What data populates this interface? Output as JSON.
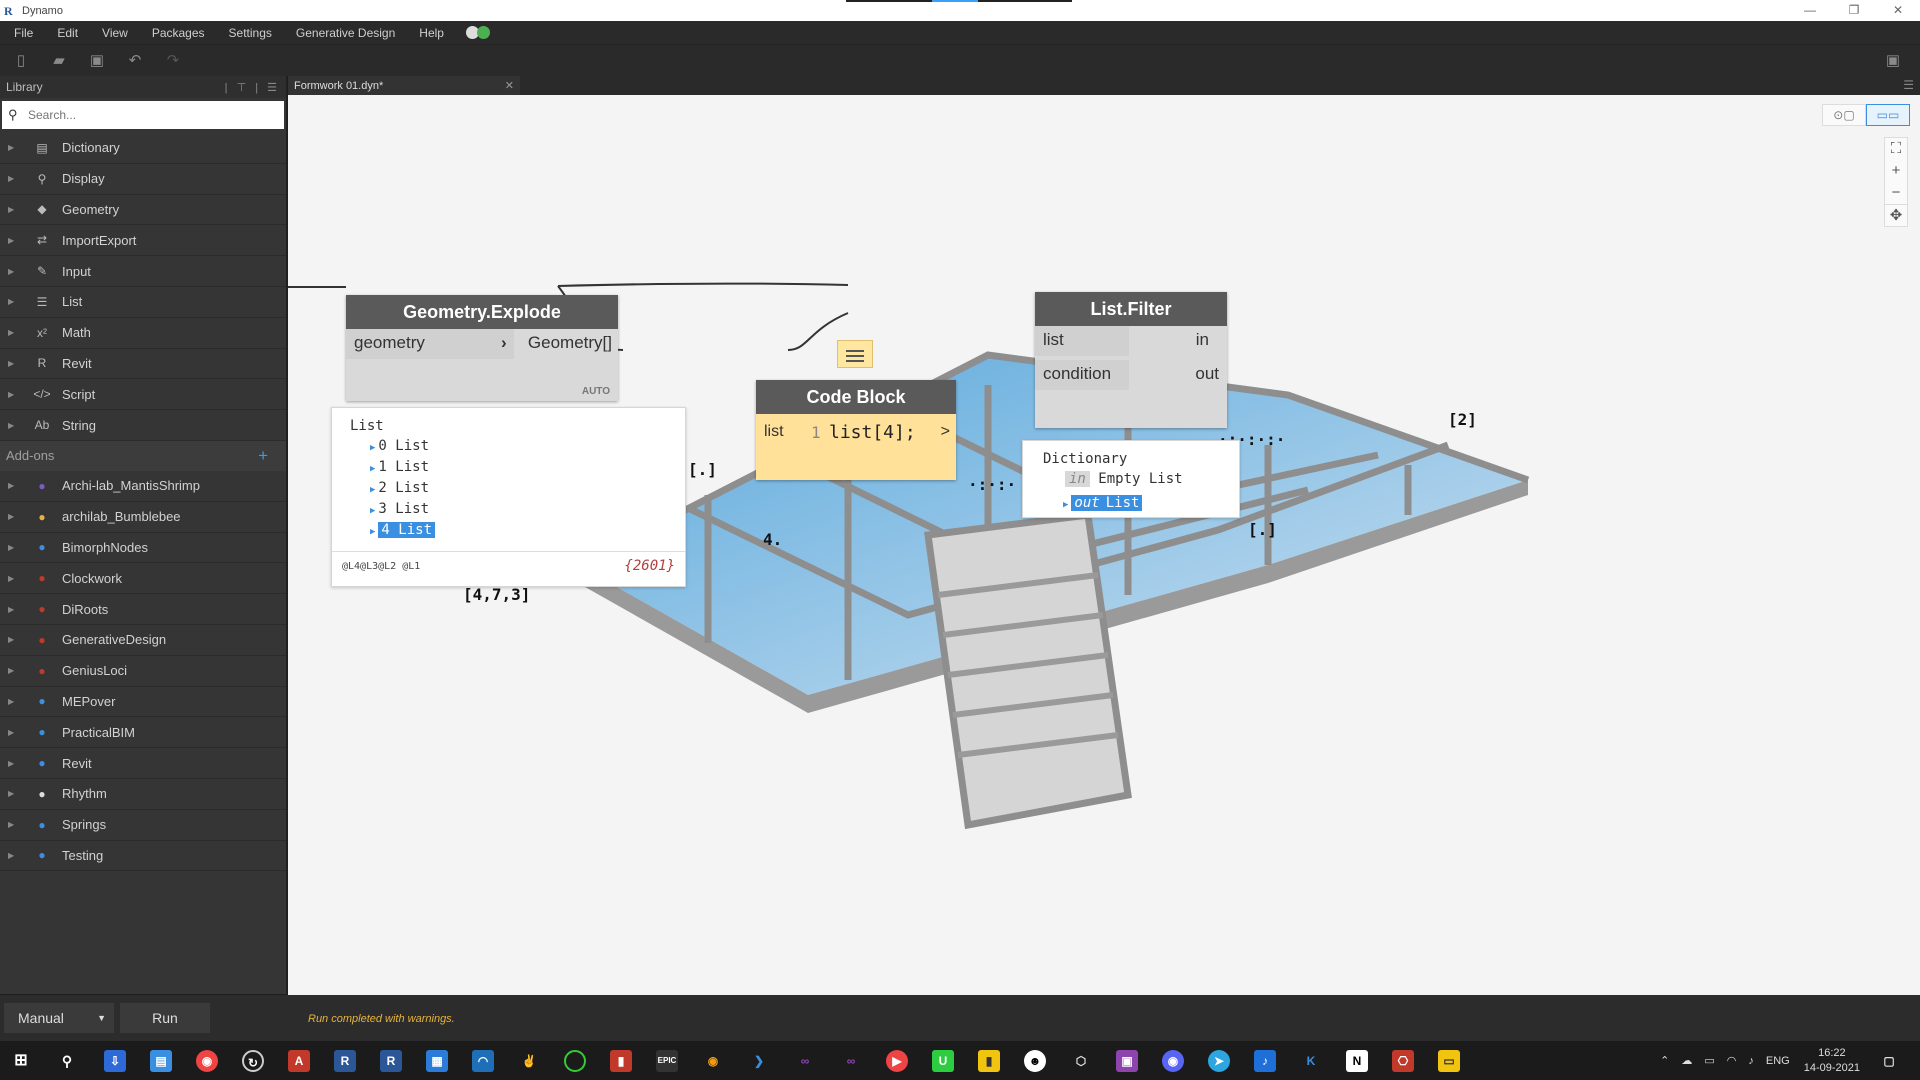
{
  "window": {
    "title": "Dynamo",
    "minimize": "—",
    "restore": "❐",
    "close": "✕"
  },
  "menu": [
    "File",
    "Edit",
    "View",
    "Packages",
    "Settings",
    "Generative Design",
    "Help"
  ],
  "library": {
    "title": "Library",
    "search_placeholder": "Search...",
    "categories": [
      {
        "label": "Dictionary",
        "icon": "dictionary-icon",
        "glyph": "▤"
      },
      {
        "label": "Display",
        "icon": "magnifier-icon",
        "glyph": "⚲"
      },
      {
        "label": "Geometry",
        "icon": "cube-icon",
        "glyph": "◆"
      },
      {
        "label": "ImportExport",
        "icon": "arrows-icon",
        "glyph": "⇄"
      },
      {
        "label": "Input",
        "icon": "pencil-icon",
        "glyph": "✎"
      },
      {
        "label": "List",
        "icon": "list-icon",
        "glyph": "☰"
      },
      {
        "label": "Math",
        "icon": "math-icon",
        "glyph": "x²"
      },
      {
        "label": "Revit",
        "icon": "revit-icon",
        "glyph": "R"
      },
      {
        "label": "Script",
        "icon": "code-icon",
        "glyph": "</>"
      },
      {
        "label": "String",
        "icon": "string-icon",
        "glyph": "Ab"
      }
    ],
    "addons_title": "Add-ons",
    "addons": [
      {
        "label": "Archi-lab_MantisShrimp",
        "color": "#7b5cc4"
      },
      {
        "label": "archilab_Bumblebee",
        "color": "#e6b33a"
      },
      {
        "label": "BimorphNodes",
        "color": "#3a8fe0"
      },
      {
        "label": "Clockwork",
        "color": "#c0392b"
      },
      {
        "label": "DiRoots",
        "color": "#c0392b"
      },
      {
        "label": "GenerativeDesign",
        "color": "#c0392b"
      },
      {
        "label": "GeniusLoci",
        "color": "#c0392b"
      },
      {
        "label": "MEPover",
        "color": "#3a8fe0"
      },
      {
        "label": "PracticalBIM",
        "color": "#3a8fe0"
      },
      {
        "label": "Revit",
        "color": "#3a8fe0"
      },
      {
        "label": "Rhythm",
        "color": "#dddddd"
      },
      {
        "label": "Springs",
        "color": "#3a8fe0"
      },
      {
        "label": "Testing",
        "color": "#3a8fe0"
      }
    ]
  },
  "tab": {
    "label": "Formwork 01.dyn*",
    "close": "✕"
  },
  "nodes": {
    "explode": {
      "title": "Geometry.Explode",
      "input": "geometry",
      "output": "Geometry[]",
      "lacing": "AUTO",
      "preview": {
        "header": "List",
        "items": [
          "0 List",
          "1 List",
          "2 List",
          "3 List",
          "4 List"
        ],
        "levels": "@L4@L3@L2 @L1",
        "count": "{2601}"
      }
    },
    "code_block": {
      "title": "Code Block",
      "input": "list",
      "line_no": "1",
      "code": "list[4];",
      "output": ">"
    },
    "filter": {
      "title": "List.Filter",
      "inputs": [
        "list",
        "condition"
      ],
      "outputs": [
        "in",
        "out"
      ],
      "preview": {
        "header": "Dictionary",
        "in_key": "in",
        "in_value": "Empty List",
        "out_key": "out",
        "out_value": "List"
      }
    }
  },
  "statusbar": {
    "run_mode": "Manual",
    "run_button": "Run",
    "message": "Run completed with warnings."
  },
  "tray": {
    "lang": "ENG",
    "time": "16:22",
    "date": "14-09-2021"
  },
  "colors": {
    "accent": "#3a8fe0",
    "code_block": "#ffe19a",
    "warning": "#e8b33a",
    "toggle_on": "#4caf50"
  }
}
